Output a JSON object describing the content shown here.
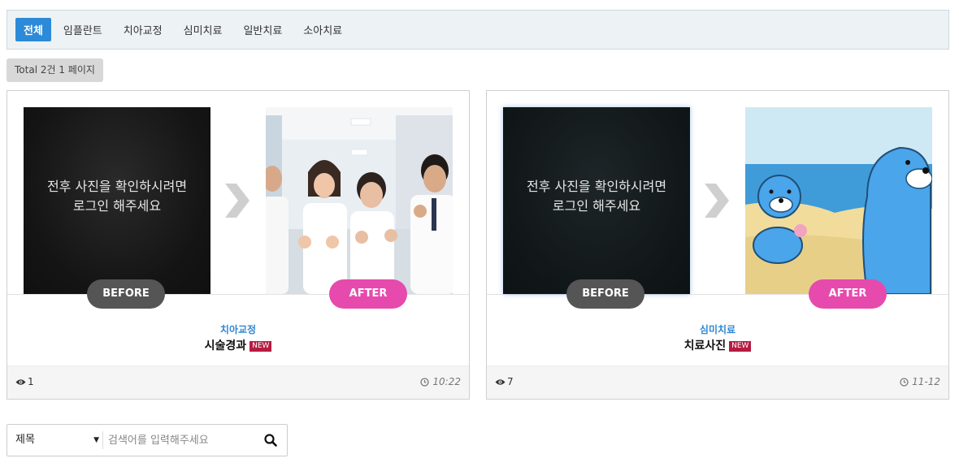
{
  "tabs": [
    {
      "label": "전체",
      "active": true
    },
    {
      "label": "임플란트",
      "active": false
    },
    {
      "label": "치아교정",
      "active": false
    },
    {
      "label": "심미치료",
      "active": false
    },
    {
      "label": "일반치료",
      "active": false
    },
    {
      "label": "소아치료",
      "active": false
    }
  ],
  "total_text": "Total 2건 1 페이지",
  "cards": [
    {
      "login_line1": "전후 사진을 확인하시려면",
      "login_line2": "로그인 해주세요",
      "before_label": "BEFORE",
      "after_label": "AFTER",
      "category": "치아교정",
      "title": "시술경과",
      "new_badge": "NEW",
      "views": "1",
      "time": "10:22"
    },
    {
      "login_line1": "전후 사진을 확인하시려면",
      "login_line2": "로그인 해주세요",
      "before_label": "BEFORE",
      "after_label": "AFTER",
      "category": "심미치료",
      "title": "치료사진",
      "new_badge": "NEW",
      "views": "7",
      "time": "11-12"
    }
  ],
  "search": {
    "field_selected": "제목",
    "placeholder": "검색어를 입력해주세요"
  },
  "colors": {
    "tab_active": "#2c8ad8",
    "after_pill": "#e64aad",
    "before_pill": "#555555",
    "category": "#2f87d4",
    "new_badge": "#b51c41"
  },
  "icons": {
    "views": "eye-icon",
    "time": "clock-icon",
    "search": "search-icon",
    "arrow": "chevron-right-icon"
  }
}
